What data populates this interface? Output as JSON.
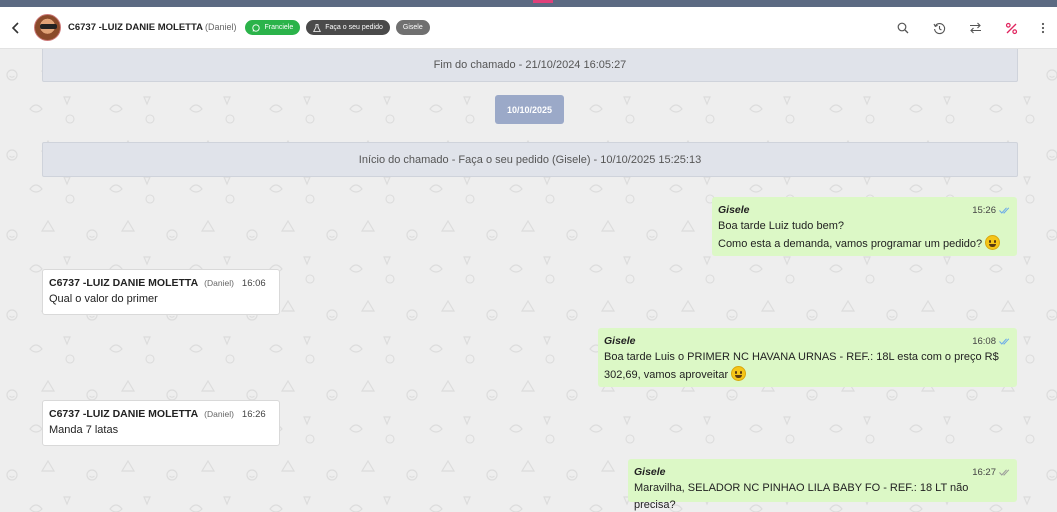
{
  "header": {
    "contact_name": "C6737 -LUIZ DANIE MOLETTA",
    "contact_sub": "(Daniel)",
    "tags": [
      {
        "label": "Franciele",
        "icon": "whatsapp-icon",
        "color": "#2bb34a"
      },
      {
        "label": "Faça o seu pedido",
        "icon": "flask-icon",
        "color": "#4a4a4a"
      },
      {
        "label": "Gisele",
        "icon": "",
        "color": "#707070"
      }
    ],
    "actions": [
      "search-icon",
      "history-icon",
      "transfer-icon",
      "percent-icon",
      "more-vertical-icon"
    ]
  },
  "chat": {
    "events": {
      "end_ticket": "Fim do chamado - 21/10/2024 16:05:27",
      "date_badge": "10/10/2025",
      "start_ticket": "Início do chamado - Faça o seu pedido (Gisele) - 10/10/2025 15:25:13"
    },
    "messages": [
      {
        "direction": "out",
        "sender": "Gisele",
        "time": "15:26",
        "lines": [
          "Boa tarde Luiz tudo bem?",
          "Como esta a demanda, vamos programar um pedido?"
        ],
        "emoji": "grinning-face-emoji"
      },
      {
        "direction": "in",
        "sender": "C6737 -LUIZ DANIE MOLETTA",
        "sender_sub": "(Daniel)",
        "time": "16:06",
        "lines": [
          "Qual o valor do primer"
        ]
      },
      {
        "direction": "out",
        "sender": "Gisele",
        "time": "16:08",
        "lines": [
          "Boa tarde Luis o PRIMER NC HAVANA URNAS - REF.: 18L esta com o preço R$",
          "302,69, vamos aproveitar"
        ],
        "emoji": "grinning-face-emoji"
      },
      {
        "direction": "in",
        "sender": "C6737 -LUIZ DANIE MOLETTA",
        "sender_sub": "(Daniel)",
        "time": "16:26",
        "lines": [
          "Manda 7 latas"
        ]
      },
      {
        "direction": "out",
        "sender": "Gisele",
        "time": "16:27",
        "lines": [
          "Maravilha, SELADOR NC PINHAO LILA BABY FO - REF.: 18 LT não precisa?"
        ]
      }
    ]
  },
  "colors": {
    "outgoing_bubble": "#dcf8c6",
    "incoming_bubble": "#ffffff",
    "system_bar": "#e0e3ea",
    "date_badge": "#9ba9c8",
    "read_tick": "#6aa9e9",
    "delivered_tick": "#999999"
  }
}
